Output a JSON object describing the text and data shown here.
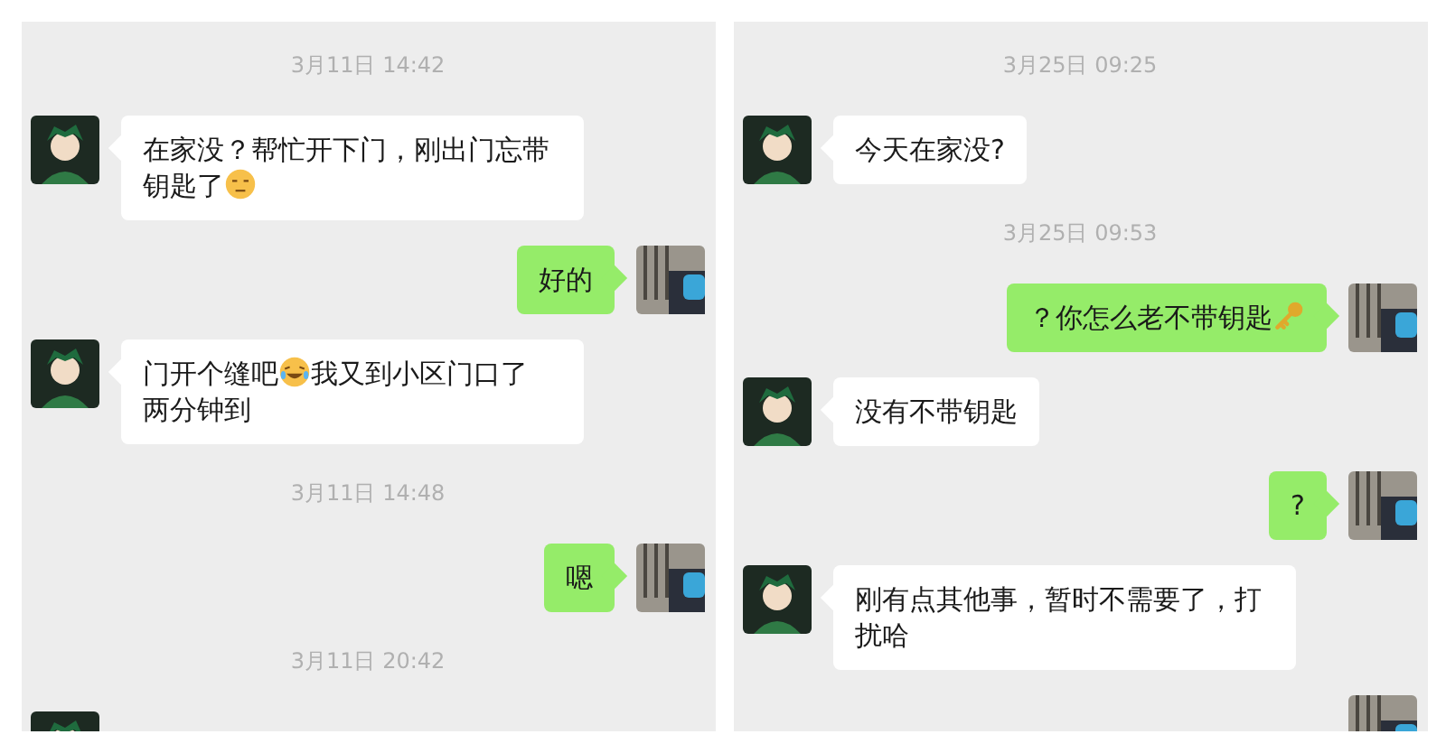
{
  "panels": [
    {
      "items": [
        {
          "kind": "time",
          "text": "3月11日 14:42"
        },
        {
          "kind": "message",
          "sent": false,
          "parts": [
            {
              "kind": "text",
              "text": "在家没？帮忙开下门，刚出门忘带"
            },
            {
              "kind": "text",
              "text": "钥匙了"
            },
            {
              "kind": "frown"
            }
          ]
        },
        {
          "kind": "message",
          "sent": true,
          "parts": [
            {
              "kind": "text",
              "text": "好的"
            }
          ]
        },
        {
          "kind": "message",
          "sent": false,
          "parts": [
            {
              "kind": "text",
              "text": "门开个缝吧"
            },
            {
              "kind": "laugh"
            },
            {
              "kind": "text",
              "text": "我又到小区门口了"
            },
            {
              "kind": "text",
              "text": "两分钟到"
            }
          ]
        },
        {
          "kind": "time",
          "text": "3月11日 14:48"
        },
        {
          "kind": "message",
          "sent": true,
          "parts": [
            {
              "kind": "text",
              "text": "嗯"
            }
          ]
        },
        {
          "kind": "time",
          "text": "3月11日 20:42"
        },
        {
          "kind": "message",
          "sent": false
        }
      ]
    },
    {
      "items": [
        {
          "kind": "time",
          "text": "3月25日 09:25"
        },
        {
          "kind": "message",
          "sent": false,
          "parts": [
            {
              "kind": "text",
              "text": "今天在家没?"
            }
          ]
        },
        {
          "kind": "time",
          "text": "3月25日 09:53"
        },
        {
          "kind": "message",
          "sent": true,
          "parts": [
            {
              "kind": "text",
              "text": "？你怎么老不带钥匙"
            },
            {
              "kind": "key"
            }
          ]
        },
        {
          "kind": "message",
          "sent": false,
          "parts": [
            {
              "kind": "text",
              "text": "没有不带钥匙"
            }
          ]
        },
        {
          "kind": "message",
          "sent": true,
          "parts": [
            {
              "kind": "text",
              "text": "?"
            }
          ]
        },
        {
          "kind": "message",
          "sent": false,
          "parts": [
            {
              "kind": "text",
              "text": "刚有点其他事，暂时不需要了，打"
            },
            {
              "kind": "text",
              "text": "扰哈"
            }
          ]
        },
        {
          "kind": "message",
          "sent": true
        }
      ]
    }
  ]
}
